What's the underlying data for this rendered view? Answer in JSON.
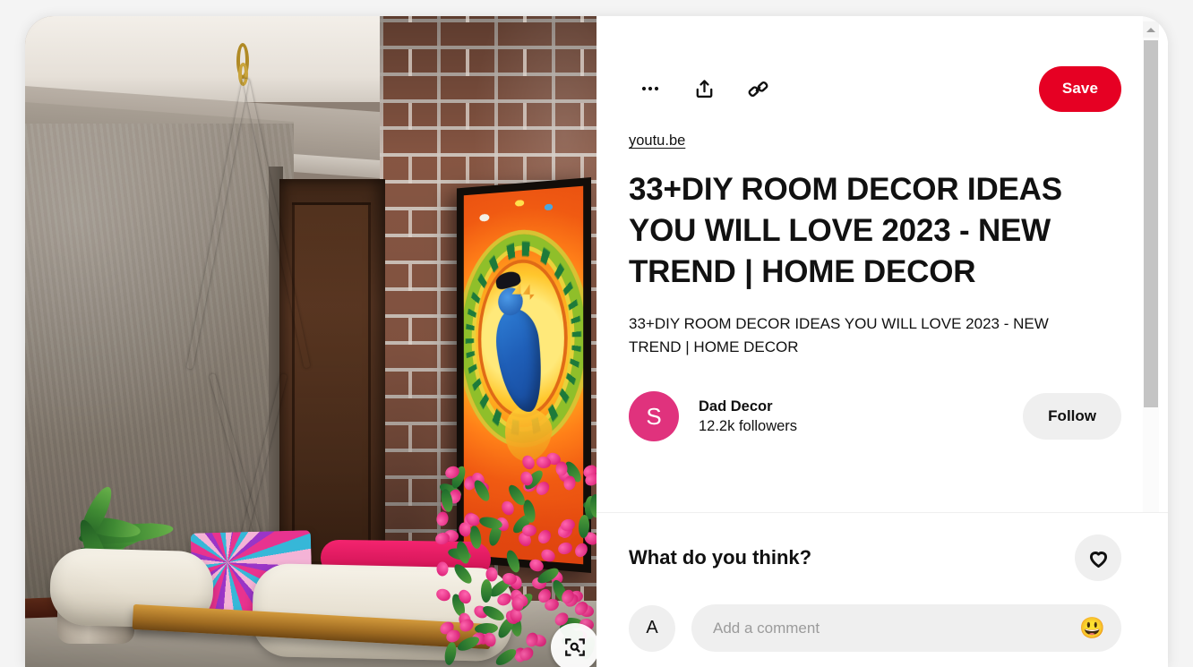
{
  "colors": {
    "brand_red": "#e60023",
    "avatar_pink": "#e0327d",
    "light_gray": "#efefef",
    "text_dark": "#111111"
  },
  "actions": {
    "more_icon": "ellipsis-icon",
    "share_icon": "share-icon",
    "link_icon": "link-icon",
    "save_label": "Save"
  },
  "pin": {
    "source_domain": "youtu.be",
    "title": "33+DIY ROOM DECOR IDEAS YOU WILL LOVE 2023 - NEW TREND | HOME DECOR",
    "description": "33+DIY ROOM DECOR IDEAS YOU WILL LOVE 2023 - NEW TREND | HOME DECOR",
    "image_alt": "Indoor wooden swing with white bolster cushions and embroidered pink pillow beside a brick wall with a framed Kerala mural of Krishna",
    "visual_search_icon": "visual-search-icon"
  },
  "creator": {
    "avatar_initial": "S",
    "name": "Dad Decor",
    "followers": "12.2k followers",
    "follow_label": "Follow"
  },
  "comments": {
    "heading": "What do you think?",
    "react_icon": "heart-icon",
    "user_avatar_initial": "A",
    "input_value": "",
    "input_placeholder": "Add a comment",
    "emoji_icon": "smiley-icon",
    "emoji_glyph": "😃"
  },
  "scrollbar": {
    "up_arrow_icon": "chevron-up-icon"
  }
}
